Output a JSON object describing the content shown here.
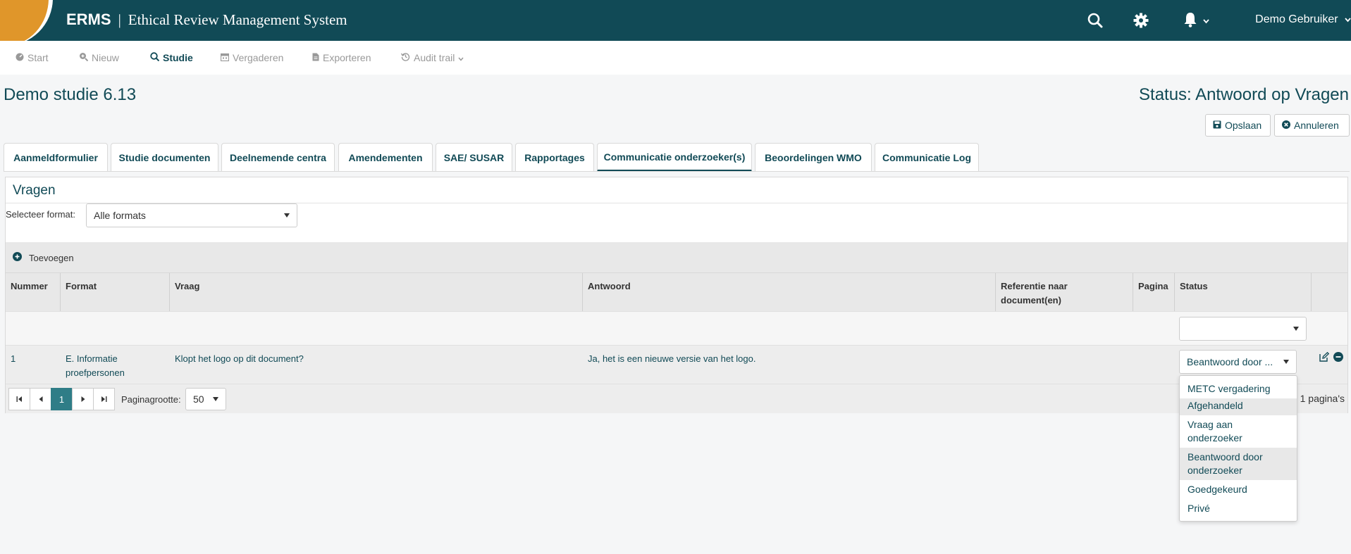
{
  "header": {
    "brand_short": "ERMS",
    "brand_separator": "|",
    "brand_full": "Ethical Review Management System",
    "user": "Demo Gebruiker",
    "icons": [
      "search-icon",
      "gear-icon",
      "bell-icon"
    ]
  },
  "nav": [
    {
      "label": "Start",
      "icon": "dashboard-icon"
    },
    {
      "label": "Nieuw",
      "icon": "search-plus-icon"
    },
    {
      "label": "Studie",
      "icon": "search-icon",
      "active": true
    },
    {
      "label": "Vergaderen",
      "icon": "calendar-icon"
    },
    {
      "label": "Exporteren",
      "icon": "file-icon"
    },
    {
      "label": "Audit trail",
      "icon": "history-icon"
    }
  ],
  "page": {
    "title": "Demo studie 6.13",
    "status": "Status: Antwoord op Vragen",
    "save_label": "Opslaan",
    "cancel_label": "Annuleren"
  },
  "tabs": [
    "Aanmeldformulier",
    "Studie documenten",
    "Deelnemende centra",
    "Amendementen",
    "SAE/ SUSAR",
    "Rapportages",
    "Communicatie onderzoeker(s)",
    "Beoordelingen WMO",
    "Communicatie Log"
  ],
  "active_tab": "Communicatie onderzoeker(s)",
  "panel": {
    "title": "Vragen",
    "format_label": "Selecteer format:",
    "format_value": "Alle formats",
    "add_label": "Toevoegen"
  },
  "table": {
    "columns": [
      "Nummer",
      "Format",
      "Vraag",
      "Antwoord",
      "Referentie naar document(en)",
      "Pagina",
      "Status"
    ],
    "rows": [
      {
        "nummer": "1",
        "format": "E. Informatie proefpersonen",
        "vraag": "Klopt het logo op dit document?",
        "antwoord": "Ja, het is een nieuwe versie van het logo.",
        "referentie": "",
        "pagina": "",
        "status": "Beantwoord door ..."
      }
    ]
  },
  "pager": {
    "current_page": "1",
    "page_size_label": "Paginagrootte:",
    "page_size": "50",
    "summary": "1 pagina's"
  },
  "status_options": [
    "METC vergadering",
    "Afgehandeld",
    "Vraag aan onderzoeker",
    "Beantwoord door onderzoeker",
    "Goedgekeurd",
    "Privé"
  ],
  "colors": {
    "primary": "#114a56",
    "accent": "#e0962a",
    "pager_active": "#2f7d87"
  }
}
